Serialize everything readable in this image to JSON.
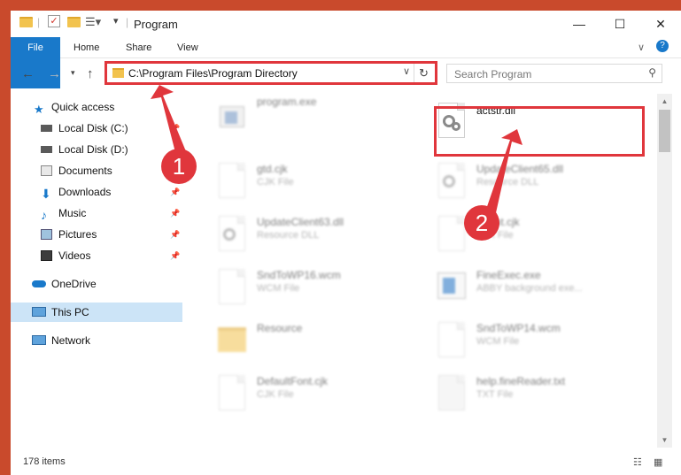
{
  "window": {
    "title": "Program"
  },
  "ribbon": {
    "tabs": [
      "File",
      "Home",
      "Share",
      "View"
    ]
  },
  "address": {
    "path": "C:\\Program Files\\Program Directory"
  },
  "search": {
    "placeholder": "Search Program"
  },
  "sidebar": {
    "items": [
      {
        "label": "Quick access",
        "icon": "star-icon"
      },
      {
        "label": "Local Disk (C:)",
        "icon": "drive-icon"
      },
      {
        "label": "Local Disk (D:)",
        "icon": "drive-icon"
      },
      {
        "label": "Documents",
        "icon": "documents-icon"
      },
      {
        "label": "Downloads",
        "icon": "download-icon"
      },
      {
        "label": "Music",
        "icon": "music-icon"
      },
      {
        "label": "Pictures",
        "icon": "pictures-icon"
      },
      {
        "label": "Videos",
        "icon": "videos-icon"
      },
      {
        "label": "OneDrive",
        "icon": "cloud-icon"
      },
      {
        "label": "This PC",
        "icon": "computer-icon"
      },
      {
        "label": "Network",
        "icon": "network-icon"
      }
    ]
  },
  "files": [
    {
      "name": "program.exe",
      "type": ""
    },
    {
      "name": "actstr.dll",
      "type": ""
    },
    {
      "name": "gtd.cjk",
      "type": "CJK File"
    },
    {
      "name": "UpdateClient65.dll",
      "type": "Resource DLL"
    },
    {
      "name": "UpdateClient63.dll",
      "type": "Resource DLL"
    },
    {
      "name": "Client.cjk",
      "type": "CJK File"
    },
    {
      "name": "SndToWP16.wcm",
      "type": "WCM File"
    },
    {
      "name": "FineExec.exe",
      "type": "ABBY background exe..."
    },
    {
      "name": "Resource",
      "type": ""
    },
    {
      "name": "SndToWP14.wcm",
      "type": "WCM File"
    },
    {
      "name": "DefaultFont.cjk",
      "type": "CJK File"
    },
    {
      "name": "help.fineReader.txt",
      "type": "TXT File"
    }
  ],
  "status": {
    "count": "178 items"
  },
  "annotations": {
    "badge1": "1",
    "badge2": "2"
  },
  "colors": {
    "accent": "#1979ca",
    "highlight": "#e0363c"
  }
}
